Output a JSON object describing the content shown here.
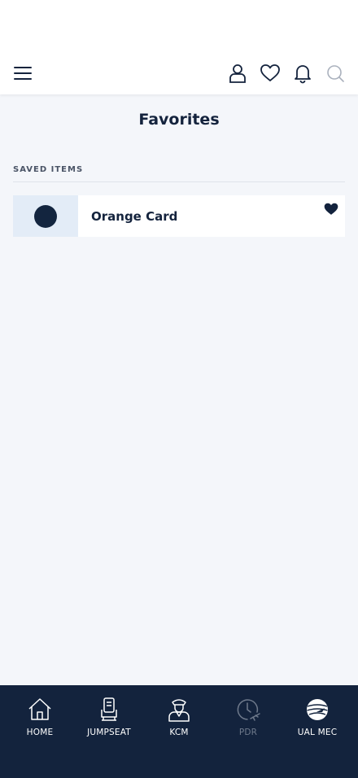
{
  "header": {
    "icons": [
      "menu-icon",
      "account-icon",
      "heart-outline-icon",
      "bell-icon",
      "search-icon"
    ]
  },
  "page": {
    "title": "Favorites",
    "section_label": "SAVED ITEMS"
  },
  "favorites": [
    {
      "title": "Orange Card",
      "icon": "heart-filled-icon"
    }
  ],
  "tabbar": {
    "tabs": [
      {
        "label": "HOME",
        "icon": "house-icon",
        "enabled": true
      },
      {
        "label": "JUMPSEAT",
        "icon": "seat-icon",
        "enabled": true
      },
      {
        "label": "KCM",
        "icon": "pilot-icon",
        "enabled": true
      },
      {
        "label": "PDR",
        "icon": "clock-plane-icon",
        "enabled": false
      },
      {
        "label": "UAL MEC",
        "icon": "globe-logo-icon",
        "enabled": true
      }
    ]
  },
  "colors": {
    "navy": "#13233d",
    "background": "#f4f6fa",
    "thumb_bg": "#e3ecf7",
    "disabled_tab": "#6f7a8c"
  }
}
